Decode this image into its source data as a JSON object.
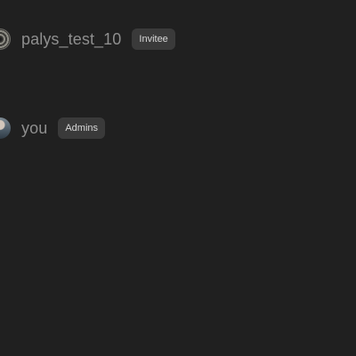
{
  "members": [
    {
      "name": "palys_test_10",
      "role": "Invitee",
      "avatar": "pattern-avatar-icon"
    },
    {
      "name": "you",
      "role": "Admins",
      "avatar": "user-photo-avatar"
    }
  ]
}
